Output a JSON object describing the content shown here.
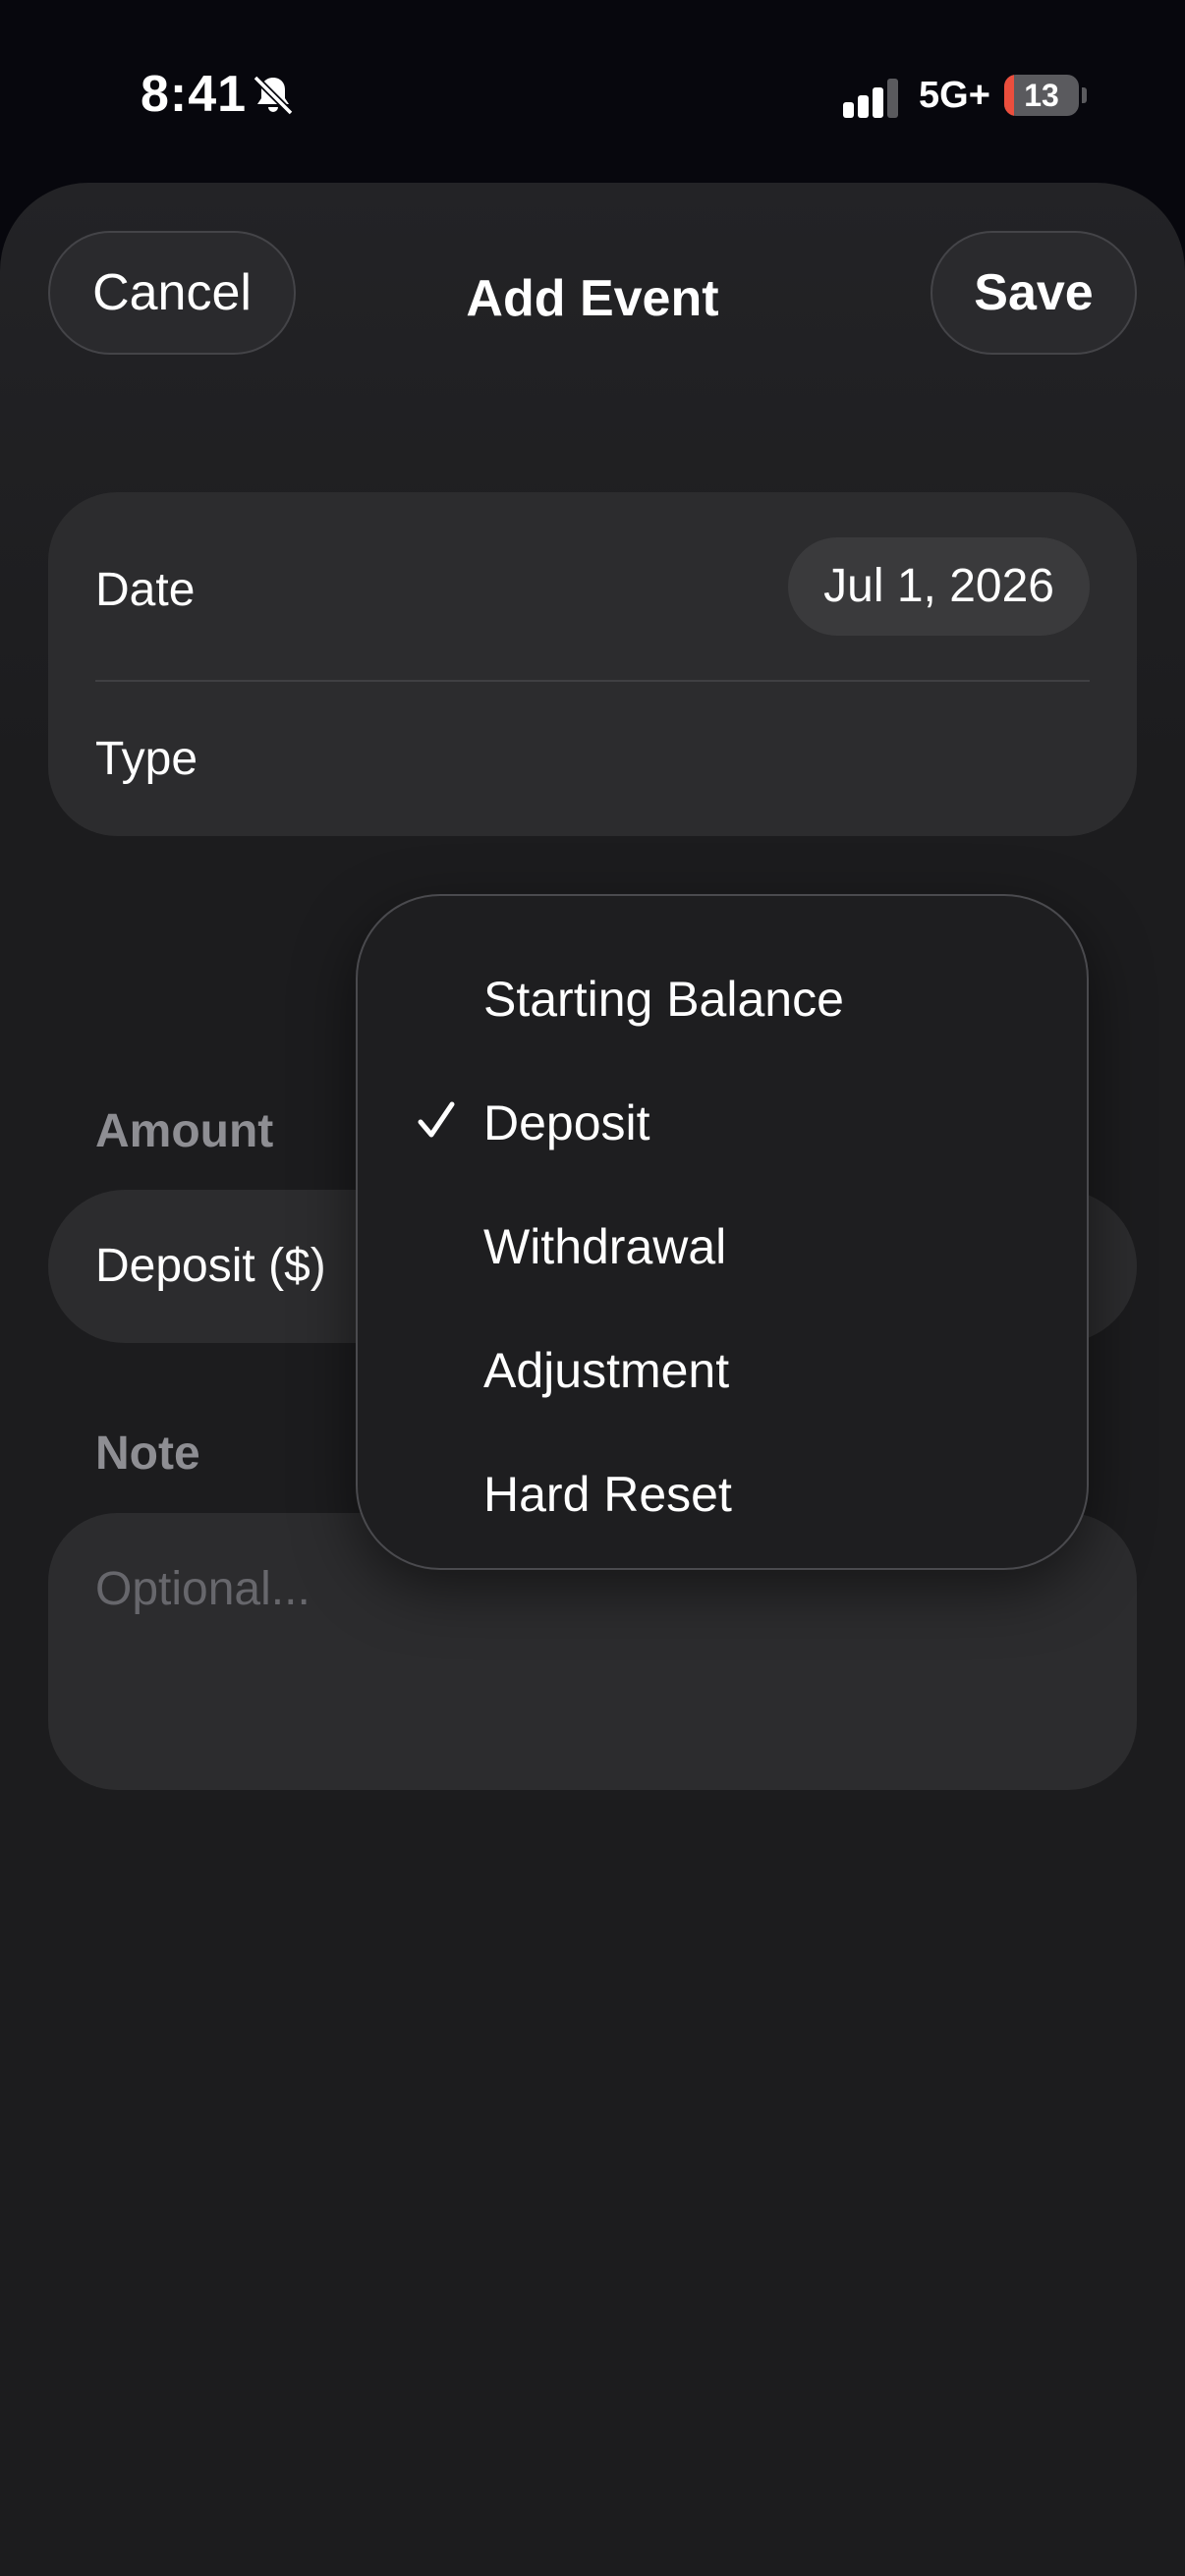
{
  "status_bar": {
    "time": "8:41",
    "network": "5G+",
    "battery_level": "13",
    "battery_fraction": 0.13,
    "icons": [
      "bell-slash-icon",
      "cellular-signal-icon",
      "battery-icon"
    ]
  },
  "nav": {
    "cancel_label": "Cancel",
    "title": "Add Event",
    "save_label": "Save"
  },
  "form": {
    "date_label": "Date",
    "date_value": "Jul 1, 2026",
    "type_label": "Type",
    "amount_header": "Amount",
    "amount_label": "Deposit ($)",
    "note_header": "Note",
    "note_placeholder": "Optional..."
  },
  "type_menu": {
    "selected": "Deposit",
    "items": [
      {
        "label": "Starting Balance",
        "checked": false
      },
      {
        "label": "Deposit",
        "checked": true
      },
      {
        "label": "Withdrawal",
        "checked": false
      },
      {
        "label": "Adjustment",
        "checked": false
      },
      {
        "label": "Hard Reset",
        "checked": false
      }
    ]
  },
  "colors": {
    "background": "#1c1c1e",
    "card": "#2c2c2e",
    "secondary_text": "#8e8e93",
    "battery_low": "#eb4e3d"
  }
}
